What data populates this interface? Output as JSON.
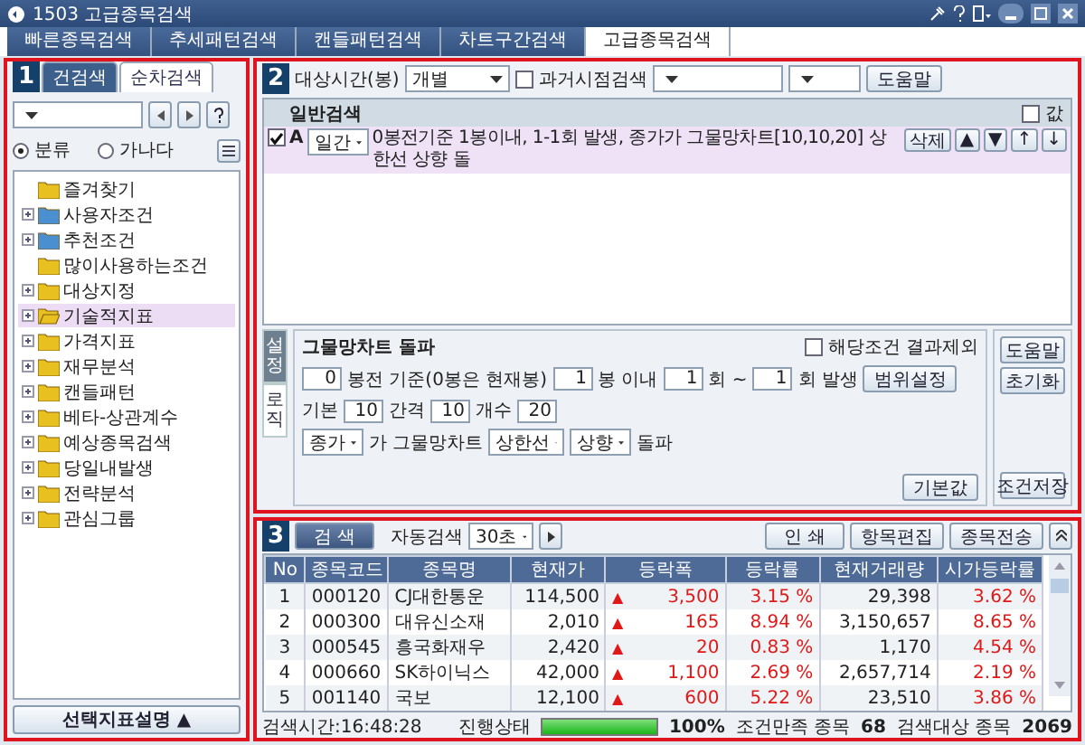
{
  "window": {
    "title": "1503 고급종목검색"
  },
  "tabs": [
    {
      "label": "빠른종목검색",
      "selected": false
    },
    {
      "label": "추세패턴검색",
      "selected": false
    },
    {
      "label": "캔들패턴검색",
      "selected": false
    },
    {
      "label": "차트구간검색",
      "selected": false
    },
    {
      "label": "고급종목검색",
      "selected": true
    }
  ],
  "left_panel": {
    "badge": "1",
    "tabs": [
      {
        "label": "건검색",
        "selected": true
      },
      {
        "label": "순차검색",
        "selected": false
      }
    ],
    "sort_options": [
      {
        "label": "분류",
        "selected": true
      },
      {
        "label": "가나다",
        "selected": false
      }
    ],
    "tree": [
      {
        "label": "즐겨찾기",
        "color": "#e8c020",
        "expandable": false,
        "selected": false
      },
      {
        "label": "사용자조건",
        "color": "#4a8fd0",
        "expandable": true,
        "selected": false
      },
      {
        "label": "추천조건",
        "color": "#4a8fd0",
        "expandable": true,
        "selected": false
      },
      {
        "label": "많이사용하는조건",
        "color": "#e8c020",
        "expandable": false,
        "selected": false
      },
      {
        "label": "대상지정",
        "color": "#e8c020",
        "expandable": true,
        "selected": false
      },
      {
        "label": "기술적지표",
        "color": "#e8c020",
        "expandable": true,
        "selected": true
      },
      {
        "label": "가격지표",
        "color": "#e8c020",
        "expandable": true,
        "selected": false
      },
      {
        "label": "재무분석",
        "color": "#e8c020",
        "expandable": true,
        "selected": false
      },
      {
        "label": "캔들패턴",
        "color": "#e8c020",
        "expandable": true,
        "selected": false
      },
      {
        "label": "베타-상관계수",
        "color": "#e8c020",
        "expandable": true,
        "selected": false
      },
      {
        "label": "예상종목검색",
        "color": "#e8c020",
        "expandable": true,
        "selected": false
      },
      {
        "label": "당일내발생",
        "color": "#e8c020",
        "expandable": true,
        "selected": false
      },
      {
        "label": "전략분석",
        "color": "#e8c020",
        "expandable": true,
        "selected": false
      },
      {
        "label": "관심그룹",
        "color": "#e8c020",
        "expandable": true,
        "selected": false
      }
    ],
    "bottom_button": "선택지표설명 ▲"
  },
  "condition_panel": {
    "badge": "2",
    "target_time_label": "대상시간(봉)",
    "target_time_value": "개별",
    "past_search": {
      "label": "과거시점검색",
      "checked": false
    },
    "help_button": "도움말",
    "list_title": "일반검색",
    "value_checkbox": {
      "label": "값",
      "checked": false
    },
    "conditions": [
      {
        "checked": true,
        "letter": "A",
        "period": "일간",
        "text": "0봉전기준 1봉이내, 1-1회 발생, 종가가 그물망차트[10,10,20] 상한선 상향 돌",
        "buttons": [
          "삭제",
          "▲",
          "▼",
          "↑",
          "↓"
        ]
      }
    ]
  },
  "settings": {
    "tabs": [
      {
        "label": "설정",
        "selected": true
      },
      {
        "label": "로직",
        "selected": false
      }
    ],
    "title": "그물망차트 돌파",
    "exclude": {
      "label": "해당조건 결과제외",
      "checked": false
    },
    "lines": [
      {
        "items": [
          {
            "kind": "field",
            "value": "0"
          },
          {
            "kind": "text",
            "value": "봉전 기준(0봉은 현재봉)"
          },
          {
            "kind": "field",
            "value": "1"
          },
          {
            "kind": "text",
            "value": "봉 이내"
          },
          {
            "kind": "field",
            "value": "1"
          },
          {
            "kind": "text",
            "value": "회 ~"
          },
          {
            "kind": "field",
            "value": "1"
          },
          {
            "kind": "text",
            "value": "회 발생"
          },
          {
            "kind": "button",
            "value": "범위설정"
          }
        ]
      },
      {
        "items": [
          {
            "kind": "text",
            "value": "기본"
          },
          {
            "kind": "field",
            "value": "10"
          },
          {
            "kind": "text",
            "value": "간격"
          },
          {
            "kind": "field",
            "value": "10"
          },
          {
            "kind": "text",
            "value": "개수"
          },
          {
            "kind": "field",
            "value": "20"
          }
        ]
      },
      {
        "items": [
          {
            "kind": "select",
            "value": "종가"
          },
          {
            "kind": "text",
            "value": "가 그물망차트"
          },
          {
            "kind": "select",
            "value": "상한선"
          },
          {
            "kind": "select",
            "value": "상향"
          },
          {
            "kind": "text",
            "value": "돌파"
          }
        ]
      }
    ],
    "default_button": "기본값",
    "side_buttons": [
      "도움말",
      "초기화",
      "조건저장"
    ]
  },
  "results": {
    "badge": "3",
    "search_button": "검 색",
    "auto_search_label": "자동검색",
    "auto_interval": "30초",
    "buttons": [
      "인 쇄",
      "항목편집",
      "종목전송"
    ],
    "table": {
      "columns": [
        "No",
        "종목코드",
        "종목명",
        "현재가",
        "등락폭",
        "등락률",
        "현재거래량",
        "시가등락률"
      ],
      "rows": [
        {
          "no": "1",
          "code": "000120",
          "name": "CJ대한통운",
          "price": "114,500",
          "sign": "▲",
          "change": "3,500",
          "rate": "3.15 %",
          "volume": "29,398",
          "open_rate": "3.62 %"
        },
        {
          "no": "2",
          "code": "000300",
          "name": "대유신소재",
          "price": "2,010",
          "sign": "▲",
          "change": "165",
          "rate": "8.94 %",
          "volume": "3,150,657",
          "open_rate": "8.65 %"
        },
        {
          "no": "3",
          "code": "000545",
          "name": "흥국화재우",
          "price": "2,420",
          "sign": "▲",
          "change": "20",
          "rate": "0.83 %",
          "volume": "1,170",
          "open_rate": "4.54 %"
        },
        {
          "no": "4",
          "code": "000660",
          "name": "SK하이닉스",
          "price": "42,000",
          "sign": "▲",
          "change": "1,100",
          "rate": "2.69 %",
          "volume": "2,657,714",
          "open_rate": "2.19 %"
        },
        {
          "no": "5",
          "code": "001140",
          "name": "국보",
          "price": "12,100",
          "sign": "▲",
          "change": "600",
          "rate": "5.22 %",
          "volume": "23,510",
          "open_rate": "3.86 %"
        }
      ]
    },
    "status": {
      "time": "검색시간:16:48:28",
      "progress_label": "진행상태",
      "level": 1,
      "percent": "100%",
      "matched_label": "조건만족 종목",
      "matched": "68",
      "target_label": "검색대상 종목",
      "target": "2069"
    }
  }
}
